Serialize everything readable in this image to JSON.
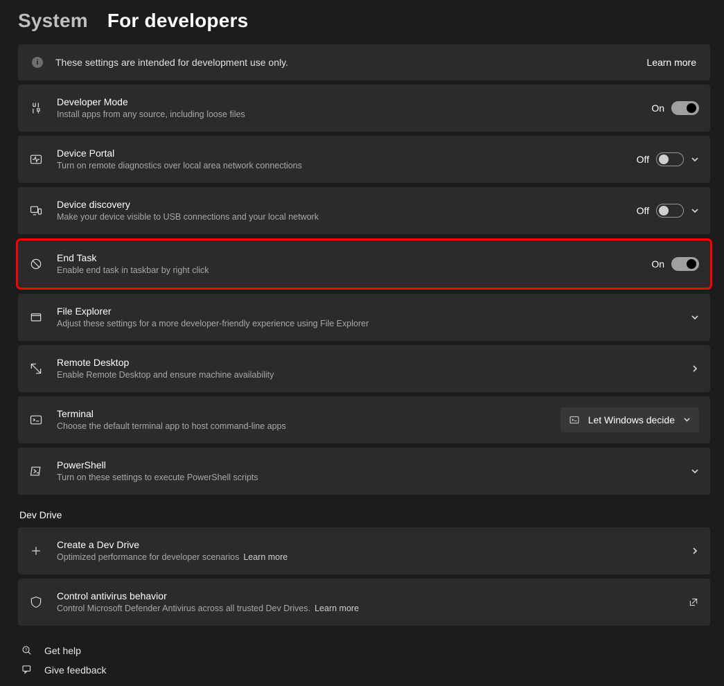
{
  "breadcrumb": {
    "parent": "System",
    "current": "For developers"
  },
  "info": {
    "message": "These settings are intended for development use only.",
    "learn_more": "Learn more"
  },
  "rows": {
    "dev_mode": {
      "title": "Developer Mode",
      "desc": "Install apps from any source, including loose files",
      "state": "On",
      "on": true
    },
    "device_portal": {
      "title": "Device Portal",
      "desc": "Turn on remote diagnostics over local area network connections",
      "state": "Off",
      "on": false
    },
    "device_discovery": {
      "title": "Device discovery",
      "desc": "Make your device visible to USB connections and your local network",
      "state": "Off",
      "on": false
    },
    "end_task": {
      "title": "End Task",
      "desc": "Enable end task in taskbar by right click",
      "state": "On",
      "on": true
    },
    "file_explorer": {
      "title": "File Explorer",
      "desc": "Adjust these settings for a more developer-friendly experience using File Explorer"
    },
    "remote_desktop": {
      "title": "Remote Desktop",
      "desc": "Enable Remote Desktop and ensure machine availability"
    },
    "terminal": {
      "title": "Terminal",
      "desc": "Choose the default terminal app to host command-line apps",
      "selected": "Let Windows decide"
    },
    "powershell": {
      "title": "PowerShell",
      "desc": "Turn on these settings to execute PowerShell scripts"
    }
  },
  "section": {
    "dev_drive": "Dev Drive"
  },
  "dev_drive": {
    "create": {
      "title": "Create a Dev Drive",
      "desc": "Optimized performance for developer scenarios",
      "learn_more": "Learn more"
    },
    "antivirus": {
      "title": "Control antivirus behavior",
      "desc": "Control Microsoft Defender Antivirus across all trusted Dev Drives.",
      "learn_more": "Learn more"
    }
  },
  "help": {
    "get_help": "Get help",
    "give_feedback": "Give feedback"
  }
}
